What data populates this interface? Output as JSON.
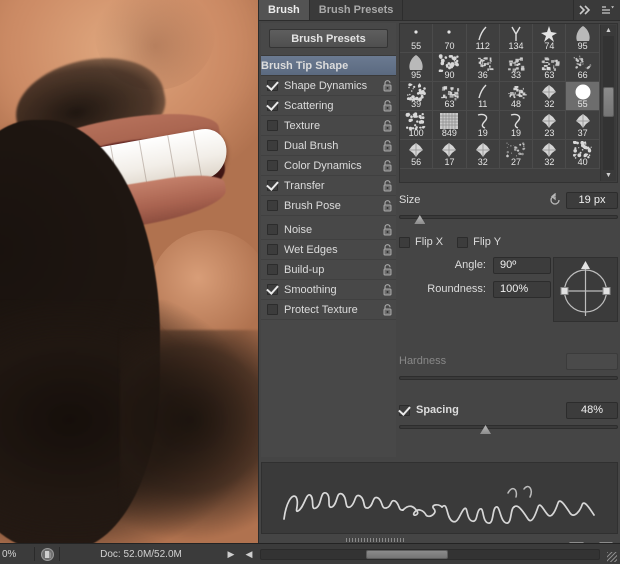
{
  "panel": {
    "tabs": [
      {
        "label": "Brush",
        "active": true
      },
      {
        "label": "Brush Presets",
        "active": false
      }
    ],
    "collapse_icon": "double-chevron-right-icon",
    "menu_icon": "panel-menu-icon",
    "presets_button": "Brush Presets"
  },
  "options": [
    {
      "label": "Brush Tip Shape",
      "header": true,
      "checked": false,
      "lock": false
    },
    {
      "label": "Shape Dynamics",
      "header": false,
      "checked": true,
      "lock": true
    },
    {
      "label": "Scattering",
      "header": false,
      "checked": true,
      "lock": true
    },
    {
      "label": "Texture",
      "header": false,
      "checked": false,
      "lock": true
    },
    {
      "label": "Dual Brush",
      "header": false,
      "checked": false,
      "lock": true
    },
    {
      "label": "Color Dynamics",
      "header": false,
      "checked": false,
      "lock": true
    },
    {
      "label": "Transfer",
      "header": false,
      "checked": true,
      "lock": true
    },
    {
      "label": "Brush Pose",
      "header": false,
      "checked": false,
      "lock": true
    },
    {
      "label": "Noise",
      "header": false,
      "checked": false,
      "lock": true
    },
    {
      "label": "Wet Edges",
      "header": false,
      "checked": false,
      "lock": true
    },
    {
      "label": "Build-up",
      "header": false,
      "checked": false,
      "lock": true
    },
    {
      "label": "Smoothing",
      "header": false,
      "checked": true,
      "lock": true
    },
    {
      "label": "Protect Texture",
      "header": false,
      "checked": false,
      "lock": true
    }
  ],
  "brush_grid": {
    "cells": [
      {
        "size": "55",
        "shape": "speck",
        "selected": false
      },
      {
        "size": "70",
        "shape": "speck",
        "selected": false
      },
      {
        "size": "112",
        "shape": "stroke",
        "selected": false
      },
      {
        "size": "134",
        "shape": "fork",
        "selected": false
      },
      {
        "size": "74",
        "shape": "star",
        "selected": false
      },
      {
        "size": "95",
        "shape": "blob",
        "selected": false
      },
      {
        "size": "95",
        "shape": "blob",
        "selected": false
      },
      {
        "size": "90",
        "shape": "spatter",
        "selected": false
      },
      {
        "size": "36",
        "shape": "chalk",
        "selected": false
      },
      {
        "size": "33",
        "shape": "chalk",
        "selected": false
      },
      {
        "size": "63",
        "shape": "chalk",
        "selected": false
      },
      {
        "size": "66",
        "shape": "spray",
        "selected": false
      },
      {
        "size": "39",
        "shape": "spatter",
        "selected": false
      },
      {
        "size": "63",
        "shape": "chalk",
        "selected": false
      },
      {
        "size": "11",
        "shape": "stroke",
        "selected": false
      },
      {
        "size": "48",
        "shape": "chalk",
        "selected": false
      },
      {
        "size": "32",
        "shape": "leaf",
        "selected": false
      },
      {
        "size": "55",
        "shape": "round",
        "selected": true
      },
      {
        "size": "100",
        "shape": "spatter",
        "selected": false
      },
      {
        "size": "849",
        "shape": "grid",
        "selected": false
      },
      {
        "size": "19",
        "shape": "hook",
        "selected": false
      },
      {
        "size": "19",
        "shape": "hook",
        "selected": false
      },
      {
        "size": "23",
        "shape": "leaf",
        "selected": false
      },
      {
        "size": "37",
        "shape": "leaf",
        "selected": false
      },
      {
        "size": "56",
        "shape": "leaf",
        "selected": false
      },
      {
        "size": "17",
        "shape": "leaf",
        "selected": false
      },
      {
        "size": "32",
        "shape": "leaf",
        "selected": false
      },
      {
        "size": "27",
        "shape": "spray",
        "selected": false
      },
      {
        "size": "32",
        "shape": "leaf",
        "selected": false
      },
      {
        "size": "40",
        "shape": "spatter",
        "selected": false
      }
    ]
  },
  "controls": {
    "size_label": "Size",
    "size_value": "19 px",
    "size_slider_pct": 7,
    "reset_icon": "reset-arrow-icon",
    "flip_x_label": "Flip X",
    "flip_x_checked": false,
    "flip_y_label": "Flip Y",
    "flip_y_checked": false,
    "angle_label": "Angle:",
    "angle_value": "90º",
    "roundness_label": "Roundness:",
    "roundness_value": "100%",
    "hardness_label": "Hardness",
    "hardness_value": "",
    "hardness_slider_pct": 0,
    "spacing_label": "Spacing",
    "spacing_checked": true,
    "spacing_value": "48%",
    "spacing_slider_pct": 37
  },
  "footer_icons": [
    {
      "name": "toggle-dirty-brush-icon"
    },
    {
      "name": "new-brush-preset-icon"
    },
    {
      "name": "create-new-brush-icon"
    }
  ],
  "statusbar": {
    "zoom": "0%",
    "thumbnail_icon": "document-thumbnail-icon",
    "doc_info": "Doc: 52.0M/52.0M",
    "play_icon": "play-arrow-icon",
    "left_icon": "left-arrow-icon"
  },
  "colors": {
    "panel_bg": "#454545",
    "header_accent": "#6b7a91",
    "tab_active_bg": "#535353",
    "field_bg": "#3c3c3c"
  }
}
